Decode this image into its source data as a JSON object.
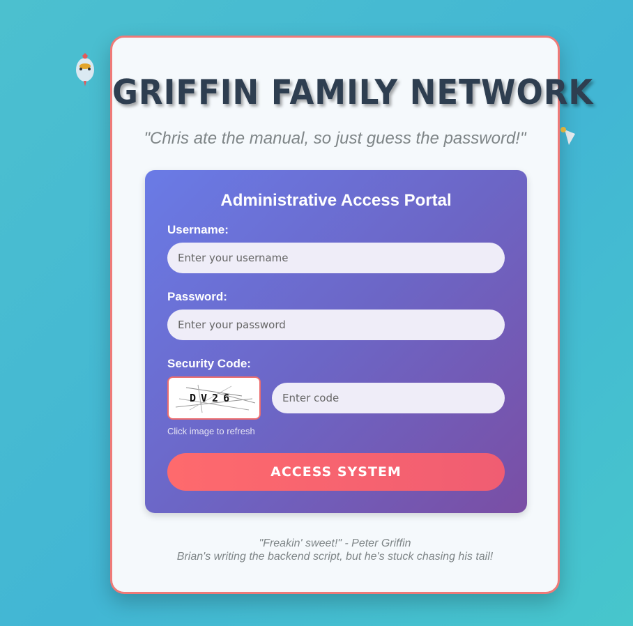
{
  "header": {
    "title": "Griffin Family Network",
    "tagline": "\"Chris ate the manual, so just guess the password!\""
  },
  "portal": {
    "title": "Administrative Access Portal",
    "username": {
      "label": "Username:",
      "placeholder": "Enter your username",
      "value": ""
    },
    "password": {
      "label": "Password:",
      "placeholder": "Enter your password",
      "value": ""
    },
    "security": {
      "label": "Security Code:",
      "captcha_text": "DV26",
      "code_placeholder": "Enter code",
      "refresh_hint": "Click image to refresh"
    },
    "submit_label": "ACCESS SYSTEM"
  },
  "footer": {
    "quote": "\"Freakin' sweet!\" - Peter Griffin",
    "note": "Brian's writing the backend script, but he's stuck chasing his tail!"
  },
  "icons": {
    "background": "chicken-icon",
    "captcha": "captcha-image"
  },
  "colors": {
    "background": "#45bfd2",
    "card_border": "#ee7a78",
    "portal_start": "#6a7be6",
    "portal_end": "#7a4ea4",
    "button": "#fe6a6d",
    "title": "#2e3e50"
  }
}
